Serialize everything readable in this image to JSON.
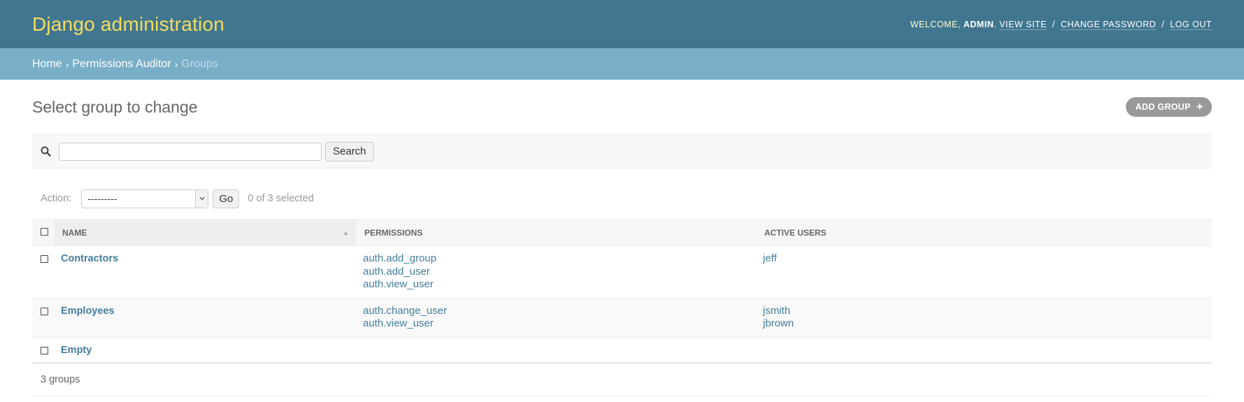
{
  "header": {
    "branding": "Django administration",
    "welcome": "Welcome,",
    "username": "admin",
    "view_site": "View site",
    "change_password": "Change password",
    "log_out": "Log out"
  },
  "breadcrumbs": {
    "home": "Home",
    "app": "Permissions Auditor",
    "current": "Groups",
    "separator": "›"
  },
  "page": {
    "title": "Select group to change",
    "add_button": "Add group",
    "add_icon": "+"
  },
  "search": {
    "value": "",
    "placeholder": "",
    "button": "Search",
    "icon": "search-icon"
  },
  "actions": {
    "label": "Action:",
    "selected_option": "---------",
    "go": "Go",
    "counter": "0 of 3 selected"
  },
  "table": {
    "columns": [
      "Name",
      "Permissions",
      "Active users"
    ],
    "sorted_column": "Name",
    "rows": [
      {
        "name": "Contractors",
        "permissions": [
          "auth.add_group",
          "auth.add_user",
          "auth.view_user"
        ],
        "users": [
          "jeff"
        ]
      },
      {
        "name": "Employees",
        "permissions": [
          "auth.change_user",
          "auth.view_user"
        ],
        "users": [
          "jsmith",
          "jbrown"
        ]
      },
      {
        "name": "Empty",
        "permissions": [],
        "users": []
      }
    ]
  },
  "paginator": "3 groups",
  "colors": {
    "header_bg": "#417690",
    "branding": "#f5dd5d",
    "breadcrumb_bg": "#79aec8",
    "link": "#447e9b"
  }
}
